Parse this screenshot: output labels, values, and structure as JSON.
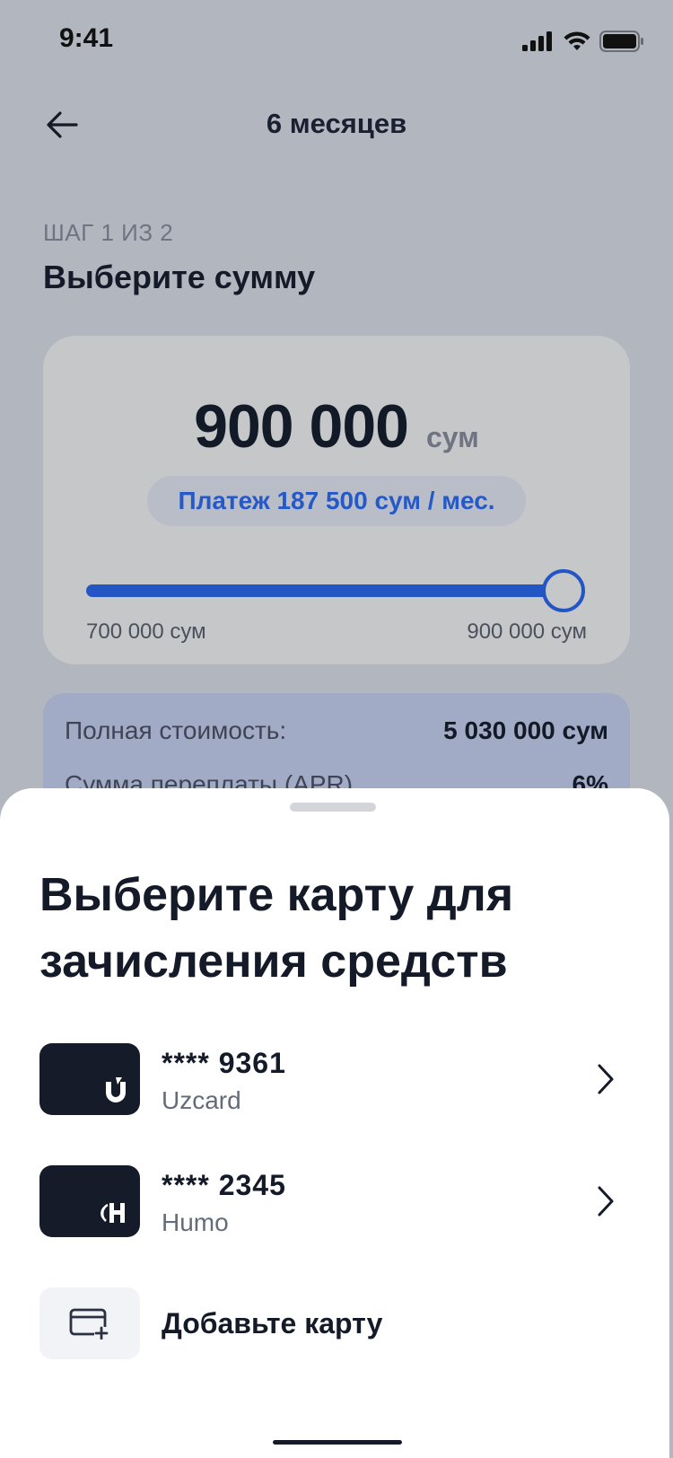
{
  "status_bar": {
    "time": "9:41",
    "icons": [
      "cellular-signal-icon",
      "wifi-icon",
      "battery-icon"
    ]
  },
  "header": {
    "title": "6 месяцев",
    "back_icon": "arrow-left-icon"
  },
  "step": {
    "label": "ШАГ 1 ИЗ 2",
    "title": "Выберите сумму"
  },
  "amount": {
    "value": "900 000",
    "unit": "сум",
    "payment": "Платеж 187 500 сум / мес.",
    "slider": {
      "min_label": "700 000 сум",
      "max_label": "900 000 сум",
      "min": 700000,
      "max": 900000,
      "value": 900000
    }
  },
  "summary": {
    "rows": [
      {
        "label": "Полная стоимость:",
        "value": "5 030 000 сум"
      },
      {
        "label": "Сумма переплаты (APR)",
        "value": "6%"
      }
    ]
  },
  "sheet": {
    "title": "Выберите карту для зачисления средств",
    "cards": [
      {
        "number": "**** 9361",
        "type": "Uzcard",
        "logo_icon": "uzcard-logo-icon"
      },
      {
        "number": "**** 2345",
        "type": "Humo",
        "logo_icon": "humo-logo-icon"
      }
    ],
    "add_card": {
      "label": "Добавьте карту",
      "icon": "add-card-icon"
    }
  },
  "colors": {
    "accent": "#2355c4",
    "backdrop": "#b2b6bf",
    "card_dark": "#151b29",
    "text_primary": "#141a28"
  }
}
